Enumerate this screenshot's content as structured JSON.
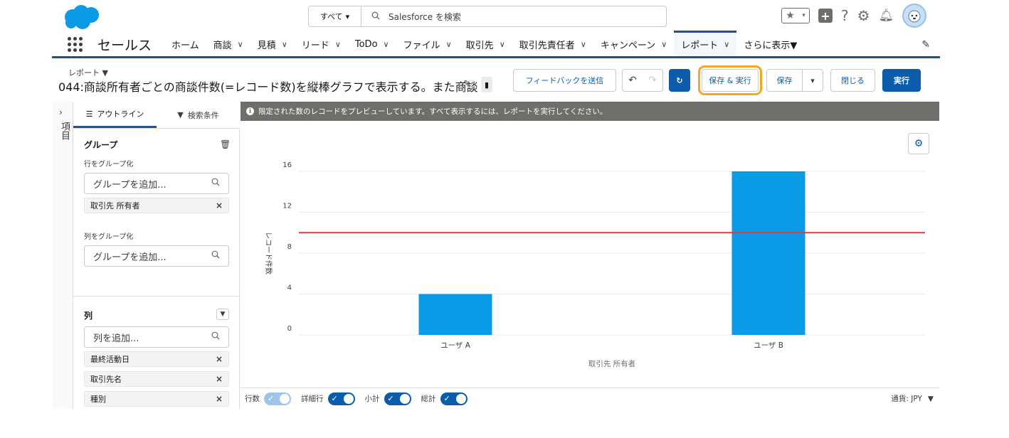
{
  "colors": {
    "brand": "#0b5cab",
    "bar": "#0b9ae6",
    "goal_line": "#e03a3a",
    "banner": "#706e6b",
    "highlight": "#f5a623"
  },
  "header": {
    "search_scope": "すべて",
    "search_placeholder": "Salesforce を検索"
  },
  "nav": {
    "app_name": "セールス",
    "items": [
      {
        "label": "ホーム",
        "chevron": false
      },
      {
        "label": "商談",
        "chevron": true
      },
      {
        "label": "見積",
        "chevron": true
      },
      {
        "label": "リード",
        "chevron": true
      },
      {
        "label": "ToDo",
        "chevron": true
      },
      {
        "label": "ファイル",
        "chevron": true
      },
      {
        "label": "取引先",
        "chevron": true
      },
      {
        "label": "取引先責任者",
        "chevron": true
      },
      {
        "label": "キャンペーン",
        "chevron": true
      },
      {
        "label": "レポート",
        "chevron": true,
        "active": true
      }
    ],
    "more_label": "さらに表示▼"
  },
  "report": {
    "type_label": "レポート ▼",
    "title": "044:商談所有者ごとの商談件数(=レコード数)を縦棒グラフで表示する。また商談"
  },
  "toolbar": {
    "feedback": "フィードバックを送信",
    "save_run": "保存 & 実行",
    "save": "保存",
    "close": "閉じる",
    "run": "実行"
  },
  "side": {
    "vertical_tab": "項目",
    "tab_outline": "アウトライン",
    "tab_filters": "検索条件",
    "groups_title": "グループ",
    "row_group_label": "行をグループ化",
    "add_group_placeholder": "グループを追加...",
    "row_groups": [
      "取引先 所有者"
    ],
    "col_group_label": "列をグループ化",
    "columns_title": "列",
    "add_column_placeholder": "列を追加...",
    "columns": [
      "最終活動日",
      "取引先名",
      "種別"
    ]
  },
  "preview": {
    "banner": "限定された数のレコードをプレビューしています。すべて表示するには、レポートを実行してください。"
  },
  "chart_data": {
    "type": "bar",
    "categories": [
      "ユーザ A",
      "ユーザ B"
    ],
    "values": [
      4,
      16
    ],
    "xlabel": "取引先 所有者",
    "ylabel": "レコード件数",
    "ylim": [
      0,
      16
    ],
    "yticks": [
      0,
      4,
      8,
      12,
      16
    ],
    "reference_line": 10,
    "grid": true
  },
  "footer": {
    "row_counts": "行数",
    "detail_rows": "詳細行",
    "subtotals": "小計",
    "grand_total": "総計",
    "currency": "通貨: JPY"
  }
}
